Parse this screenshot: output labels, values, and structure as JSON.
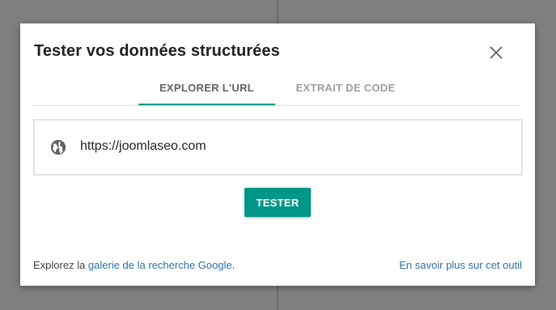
{
  "dialog": {
    "title": "Tester vos données structurées",
    "close_icon": "close-icon"
  },
  "tabs": [
    {
      "label": "EXPLORER L'URL",
      "active": true
    },
    {
      "label": "EXTRAIT DE CODE",
      "active": false
    }
  ],
  "url_field": {
    "icon": "globe-icon",
    "value": "https://joomlaseo.com"
  },
  "actions": {
    "test_label": "TESTER"
  },
  "footer": {
    "explore_prefix": "Explorez la ",
    "gallery_link": "galerie de la recherche Google",
    "explore_suffix": ".",
    "learn_more_link": "En savoir plus sur cet outil"
  },
  "colors": {
    "accent": "#009688",
    "link": "#2a6fa8",
    "backdrop": "#7f7f7f"
  }
}
